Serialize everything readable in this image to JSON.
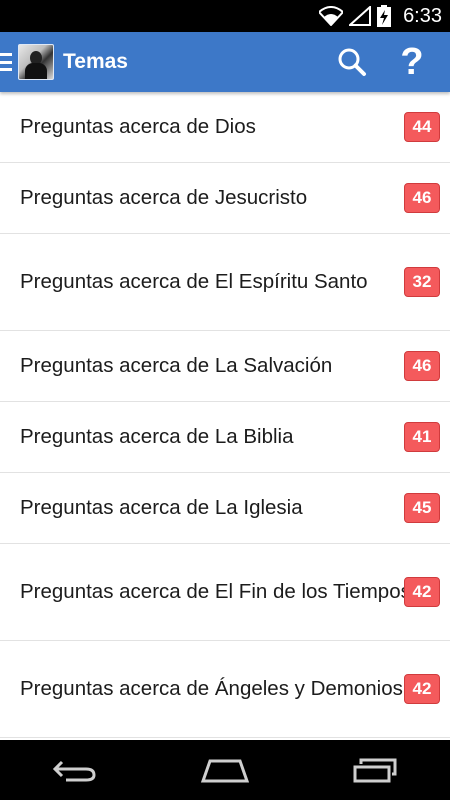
{
  "status_bar": {
    "time": "6:33",
    "icons": [
      "wifi-icon",
      "signal-icon",
      "battery-charging-icon"
    ]
  },
  "app_bar": {
    "title": "Temas",
    "icons": [
      "menu-icon",
      "avatar",
      "search-icon",
      "help-icon"
    ],
    "help_glyph": "?",
    "color": "#3d78c8"
  },
  "topics": [
    {
      "label": "Preguntas acerca de Dios",
      "count": "44"
    },
    {
      "label": "Preguntas acerca de Jesucristo",
      "count": "46"
    },
    {
      "label": "Preguntas acerca de El Espíritu Santo",
      "count": "32"
    },
    {
      "label": "Preguntas acerca de La Salvación",
      "count": "46"
    },
    {
      "label": "Preguntas acerca de La Biblia",
      "count": "41"
    },
    {
      "label": "Preguntas acerca de La Iglesia",
      "count": "45"
    },
    {
      "label": "Preguntas acerca de El Fin de los Tiempos",
      "count": "42"
    },
    {
      "label": "Preguntas acerca de Ángeles y Demonios",
      "count": "42"
    }
  ],
  "badge_color": "#f45a5c",
  "nav_bar": {
    "icons": [
      "back-icon",
      "home-icon",
      "recent-apps-icon"
    ]
  }
}
